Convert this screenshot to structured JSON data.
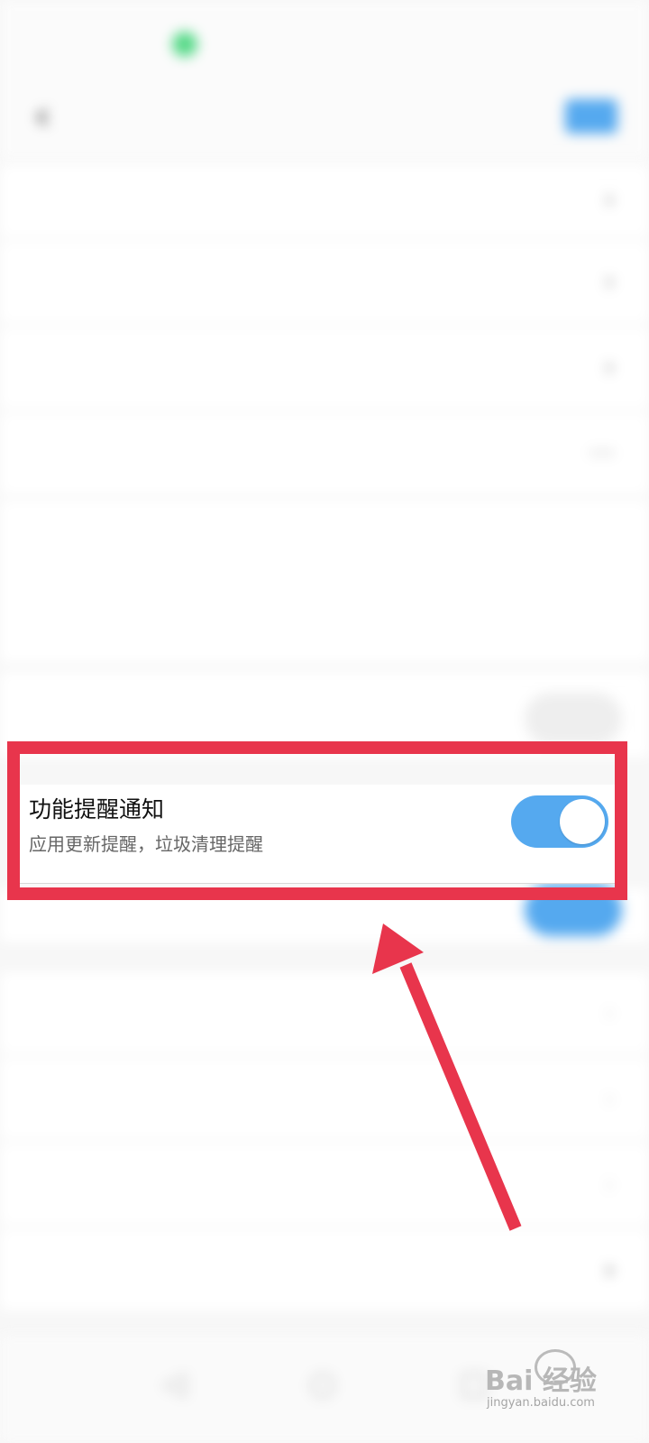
{
  "status_bar": {
    "time": "",
    "indicators": ""
  },
  "header": {
    "back_icon": "chevron-left-icon",
    "title": "",
    "action_label": ""
  },
  "background_rows": [
    {
      "label": "",
      "value": ""
    },
    {
      "label": "",
      "value": ""
    },
    {
      "label": "",
      "value": ""
    },
    {
      "label": "",
      "value": ""
    },
    {
      "label": "",
      "value": ""
    },
    {
      "label": "",
      "value": ""
    }
  ],
  "focused_setting": {
    "title": "功能提醒通知",
    "subtitle": "应用更新提醒，垃圾清理提醒",
    "enabled": true
  },
  "annotation": {
    "highlight_color": "#e8354c",
    "arrow_color": "#e8354c"
  },
  "watermark": {
    "main": "Bai 经验",
    "sub": "jingyan.baidu.com"
  }
}
